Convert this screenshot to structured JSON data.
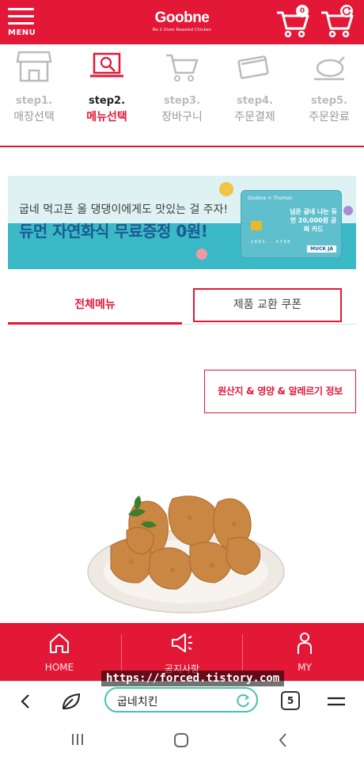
{
  "header": {
    "menu_label": "MENU",
    "logo_text": "Goobne",
    "logo_sub": "No.1 Oven Roasted Chicken",
    "cart_count_1": "0",
    "cart_count_2": "0",
    "brand_color": "#e31837"
  },
  "steps": [
    {
      "num": "step1.",
      "name": "매장선택",
      "icon": "store-icon",
      "active": false
    },
    {
      "num": "step2.",
      "name": "메뉴선택",
      "icon": "menu-laptop-icon",
      "active": true
    },
    {
      "num": "step3.",
      "name": "장바구니",
      "icon": "cart-icon",
      "active": false
    },
    {
      "num": "step4.",
      "name": "주문결제",
      "icon": "card-icon",
      "active": false
    },
    {
      "num": "step5.",
      "name": "주문완료",
      "icon": "chicken-icon",
      "active": false
    }
  ],
  "banner": {
    "line1": "굽네 먹고픈 울 댕댕이에게도 맛있는 걸 주자!",
    "line2": "듀먼 자연화식 무료증정 0원!",
    "card_brand": "Goobne × Thumon",
    "card_text": "넘은 굽네 나는 듀먼 20,000원 공짜 카드",
    "card_tag": "MUCK JA",
    "card_number": "1 8 9 3 · · · · 5 7 4 8"
  },
  "tabs": {
    "all": "전체메뉴",
    "coupon": "제품 교환 쿠폰"
  },
  "info_button": "원산지 & 영양 & 알레르기 정보",
  "bottom_nav": [
    {
      "label": "HOME",
      "icon": "home-icon"
    },
    {
      "label": "공지사항",
      "icon": "megaphone-icon"
    },
    {
      "label": "MY",
      "icon": "person-icon"
    }
  ],
  "browser": {
    "url_overlay": "https://forced.tistory.com",
    "address_text": "굽네치킨",
    "tab_count": "5"
  }
}
